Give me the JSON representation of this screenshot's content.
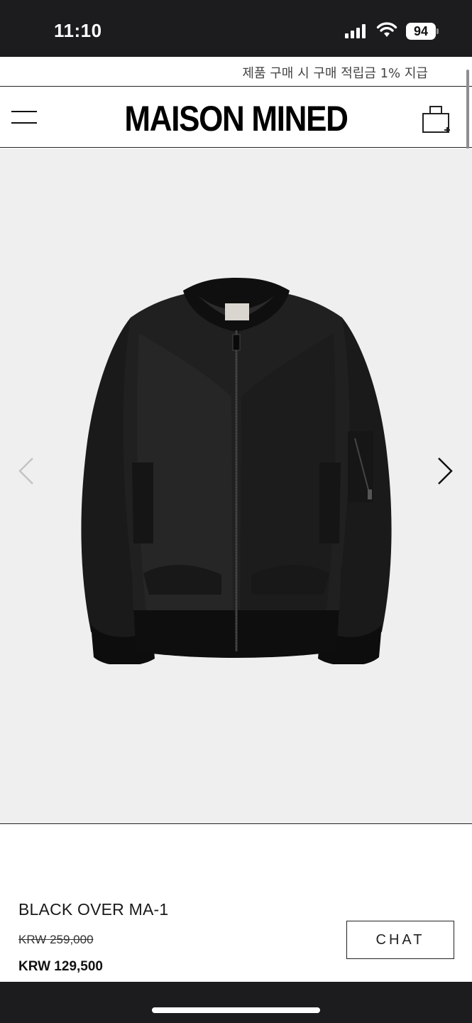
{
  "status_bar": {
    "time": "11:10",
    "battery": "94",
    "icons": [
      "signal-icon",
      "wifi-icon",
      "battery-icon"
    ]
  },
  "promo_banner": {
    "text": "제품 구매 시 구매 적립금 1% 지급"
  },
  "header": {
    "brand": "MAISON MINED",
    "icons": [
      "menu-icon",
      "cart-icon"
    ]
  },
  "gallery": {
    "image": "black bomber jacket",
    "arrows": [
      "prev-arrow-icon",
      "next-arrow-icon"
    ]
  },
  "product": {
    "name": "BLACK OVER MA-1",
    "original_price": "KRW 259,000",
    "sale_price": "KRW 129,500",
    "chat_label": "CHAT"
  },
  "colors": {
    "background": "#efefef",
    "text": "#111111",
    "status_bar": "#1c1c1e"
  }
}
